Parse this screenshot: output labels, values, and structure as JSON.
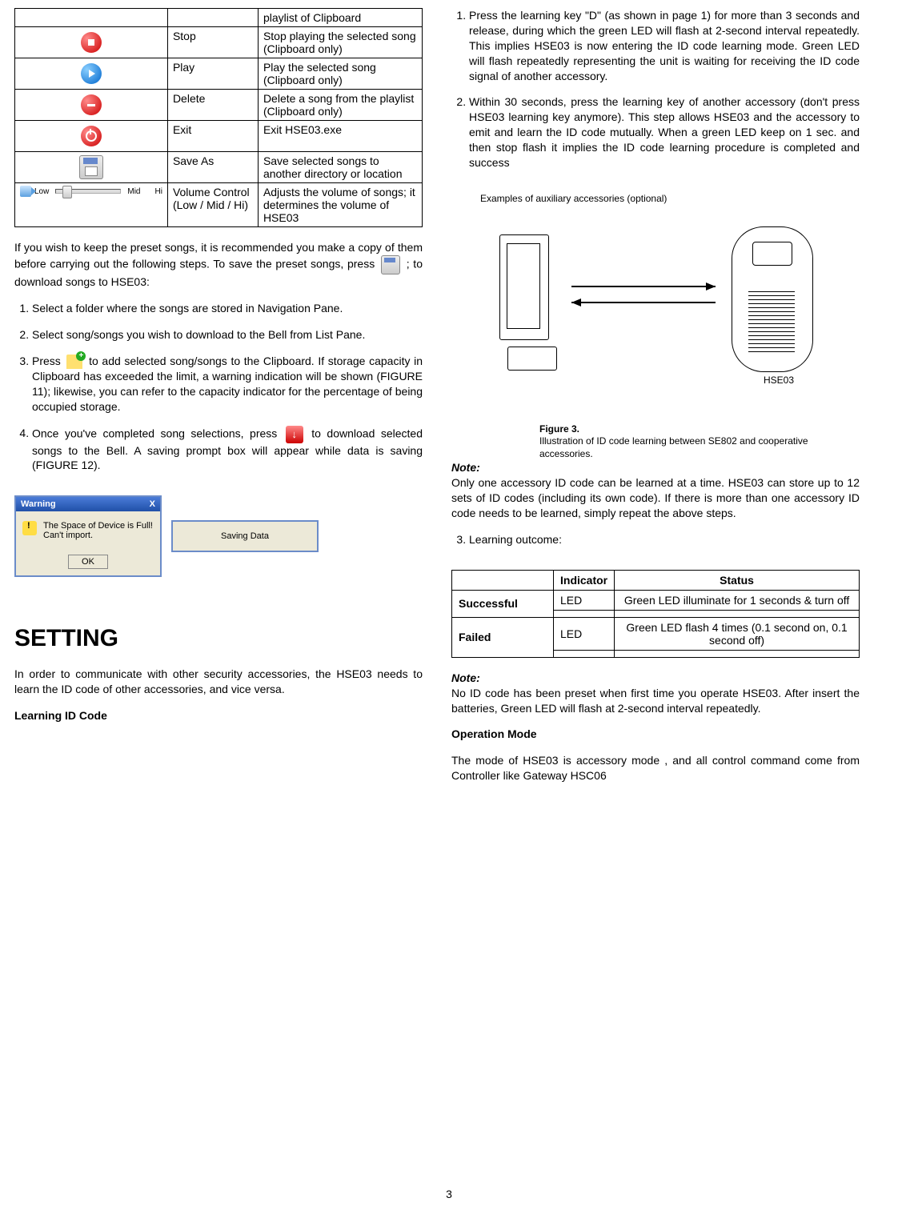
{
  "col1": {
    "tableRows": [
      {
        "name": "",
        "desc": "playlist of Clipboard",
        "iconClass": ""
      },
      {
        "name": "Stop",
        "desc": "Stop playing the selected song (Clipboard only)",
        "iconClass": "stop"
      },
      {
        "name": "Play",
        "desc": "Play the selected song (Clipboard only)",
        "iconClass": "play"
      },
      {
        "name": "Delete",
        "desc": "Delete a song from the playlist (Clipboard only)",
        "iconClass": "delete"
      },
      {
        "name": "Exit",
        "desc": "Exit HSE03.exe",
        "iconClass": "exit"
      },
      {
        "name": "Save As",
        "desc": "Save selected songs to another directory or location",
        "iconClass": "save"
      },
      {
        "name": "Volume Control (Low / Mid / Hi)",
        "desc": "Adjusts the volume of songs; it determines the volume of HSE03",
        "iconClass": "slider"
      }
    ],
    "sliderLabels": {
      "low": "Low",
      "mid": "Mid",
      "hi": "Hi"
    },
    "para1a": "If you wish to keep the preset songs, it is recommended you make a copy of them before carrying out the following steps.  To save the preset songs, press ",
    "para1b": " ; to download songs to HSE03:",
    "step1": "Select a folder where the songs are stored in Navigation Pane.",
    "step2": "Select song/songs you wish to download to the Bell from List Pane.",
    "step3a": "Press ",
    "step3b": " to add selected song/songs to the Clipboard.  If storage capacity in Clipboard has exceeded the limit, a warning indication will be shown (FIGURE 11); likewise, you can refer to the capacity indicator for the percentage of being occupied storage.",
    "step4a": "Once you've completed song selections, press ",
    "step4b": " to download selected songs to the Bell.  A saving prompt box will appear while data is saving (FIGURE 12).",
    "dlg1": {
      "title": "Warning",
      "text": "The Space of Device is Full! Can't import.",
      "ok": "OK",
      "close": "X"
    },
    "dlg2": {
      "text": "Saving Data"
    },
    "heading": "SETTING",
    "para2": "In order to communicate with other security accessories, the HSE03 needs to learn the ID code of other accessories, and vice versa.",
    "learningHdr": "Learning ID Code"
  },
  "col2": {
    "step1": "Press the learning key \"D\" (as shown in page 1) for more than 3 seconds and release, during which the green LED will flash at 2-second interval repeatedly.  This implies HSE03 is now entering the ID code learning mode.  Green LED will flash repeatedly representing the unit is waiting for receiving the ID code signal of another accessory.",
    "step2": "Within 30 seconds, press the learning key of another accessory (don't press HSE03 learning key anymore).  This step allows HSE03 and the accessory to emit and learn the ID code mutually.  When a green LED keep on 1 sec. and then stop flash it implies the ID code learning procedure is completed and success",
    "examplesLabel": "Examples of auxiliary accessories (optional)",
    "devLabel": "HSE03",
    "figTitle": "Figure 3.",
    "figDesc": "Illustration of ID code learning between SE802 and cooperative accessories.",
    "noteLabel": "Note:",
    "note1": "Only one accessory ID code can be learned at a time.  HSE03 can store up to 12 sets of ID codes (including its own code).  If there is more than one accessory ID code needs to be learned, simply repeat the above steps.",
    "step3": "Learning outcome:",
    "tbl": {
      "hIndicator": "Indicator",
      "hStatus": "Status",
      "rowSuccess": "Successful",
      "rowFailed": "Failed",
      "led": "LED",
      "successStatus": "Green LED illuminate for 1 seconds & turn off",
      "failedStatus": "Green LED flash 4 times (0.1 second on, 0.1 second off)"
    },
    "note2": "No ID code has been preset when first time you operate HSE03.  After insert the batteries, Green LED will flash at 2-second interval repeatedly.",
    "opMode": "Operation Mode",
    "opModeText": "The mode of HSE03 is accessory mode , and all control command come from Controller like Gateway HSC06"
  },
  "pageNum": "3"
}
